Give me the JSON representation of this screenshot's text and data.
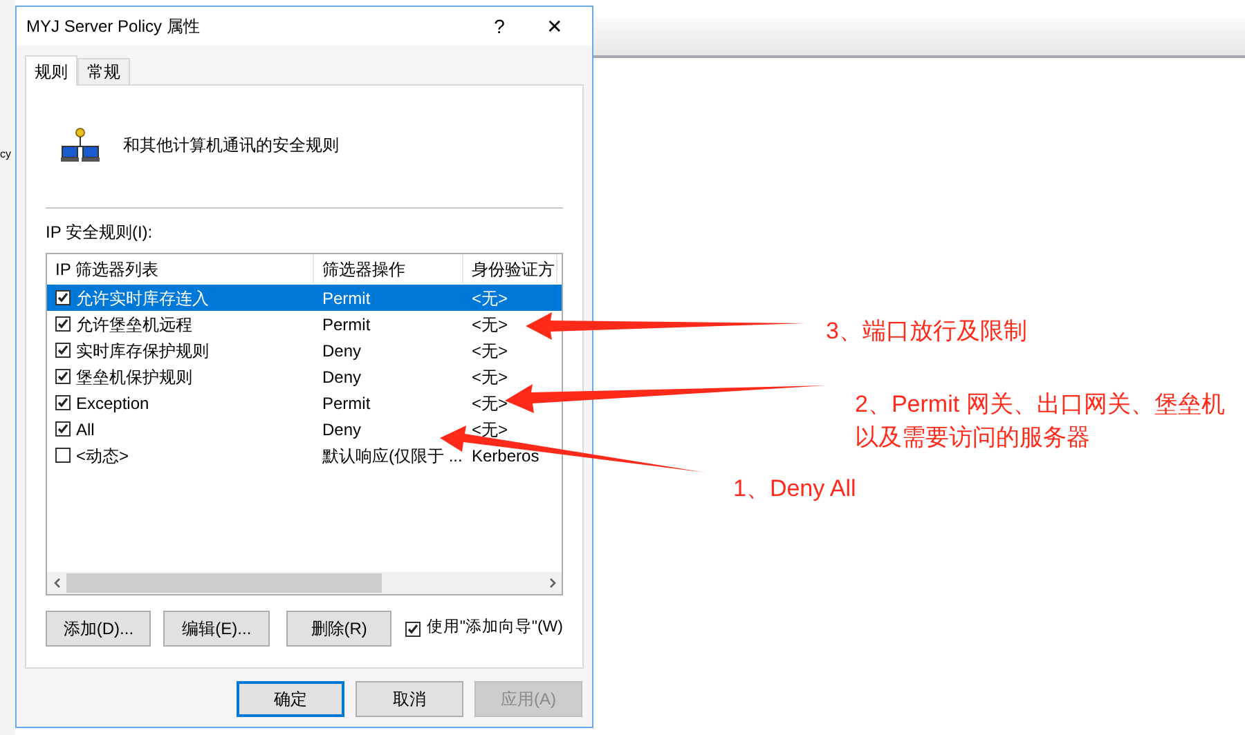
{
  "background": {
    "fragment": "cy"
  },
  "dialog": {
    "title": "MYJ Server Policy 属性",
    "help": "?",
    "close": "✕"
  },
  "tabs": [
    {
      "label": "规则",
      "selected": true
    },
    {
      "label": "常规",
      "selected": false
    }
  ],
  "intro": "和其他计算机通讯的安全规则",
  "rules_label": "IP 安全规则(I):",
  "table": {
    "columns": [
      "IP 筛选器列表",
      "筛选器操作",
      "身份验证方"
    ],
    "rows": [
      {
        "cells": [
          "允许实时库存连入",
          "Permit",
          "<无>"
        ],
        "checked": true,
        "selected": true
      },
      {
        "cells": [
          "允许堡垒机远程",
          "Permit",
          "<无>"
        ],
        "checked": true,
        "selected": false
      },
      {
        "cells": [
          "实时库存保护规则",
          "Deny",
          "<无>"
        ],
        "checked": true,
        "selected": false
      },
      {
        "cells": [
          "堡垒机保护规则",
          "Deny",
          "<无>"
        ],
        "checked": true,
        "selected": false
      },
      {
        "cells": [
          "Exception",
          "Permit",
          "<无>"
        ],
        "checked": true,
        "selected": false
      },
      {
        "cells": [
          "All",
          "Deny",
          "<无>"
        ],
        "checked": true,
        "selected": false
      },
      {
        "cells": [
          "<动态>",
          "默认响应(仅限于 ...",
          "Kerberos"
        ],
        "checked": false,
        "selected": false
      }
    ]
  },
  "actions": [
    {
      "label": "添加(D)..."
    },
    {
      "label": "编辑(E)..."
    },
    {
      "label": "删除(R)"
    }
  ],
  "wizard": {
    "label": "使用\"添加向导\"(W)",
    "checked": true
  },
  "footer": [
    {
      "label": "确定",
      "kind": "default"
    },
    {
      "label": "取消",
      "kind": "normal"
    },
    {
      "label": "应用(A)",
      "kind": "disabled"
    }
  ],
  "annotations": [
    "3、端口放行及限制",
    "2、Permit 网关、出口网关、堡垒机以及需要访问的服务器",
    "1、Deny All"
  ]
}
